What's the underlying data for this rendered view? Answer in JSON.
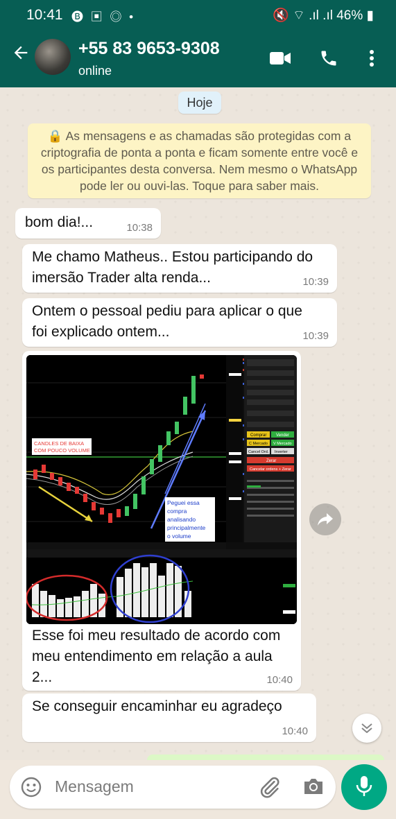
{
  "status_bar": {
    "time": "10:41",
    "left_icons": "🅑 ▣ ◎ •",
    "right_text": "🔇 ⌔ .ıl .ıl 46% ▮",
    "battery": "46%"
  },
  "header": {
    "contact_name": "+55 83 9653-9308",
    "status": "online",
    "icons": [
      "back-arrow-icon",
      "video-call-icon",
      "voice-call-icon",
      "more-options-icon"
    ]
  },
  "chat": {
    "date_chip": "Hoje",
    "encryption_notice": "🔒 As mensagens e as chamadas são protegidas com a criptografia de ponta a ponta e ficam somente entre você e os participantes desta conversa. Nem mesmo o WhatsApp pode ler ou ouvi-las. Toque para saber mais.",
    "messages": [
      {
        "text": "bom dia!...",
        "time": "10:38"
      },
      {
        "text": "Me chamo Matheus.. Estou participando do imersão Trader alta renda...",
        "time": "10:39"
      },
      {
        "text": "Ontem o pessoal pediu para aplicar o que foi explicado ontem...",
        "time": "10:39"
      },
      {
        "text": "Esse foi meu resultado de acordo com meu entendimento em relação a aula 2...",
        "time": "10:40"
      },
      {
        "text": "Se conseguir encaminhar eu agradeço",
        "time": "10:40"
      }
    ],
    "image_annotations": {
      "candles_label": "CANDLES DE BAIXA COM POUCO VOLUME",
      "note": "Peguei essa compra analisando principalmente o volume",
      "buy_button": "Comprar",
      "sell_button": "Vender",
      "buy_market": "C Mercado",
      "sell_market": "V Mercado",
      "cancel": "Cancel Ord.",
      "invert": "Inverter",
      "zero": "Zerar",
      "cancel_zero": "Cancelar ordens + Zerar"
    }
  },
  "composer": {
    "placeholder": "Mensagem",
    "icons": [
      "emoji-icon",
      "attach-icon",
      "camera-icon",
      "mic-icon"
    ]
  },
  "colors": {
    "header": "#075e54",
    "send_button": "#00a884",
    "notice_bg": "#fdf4c5"
  }
}
